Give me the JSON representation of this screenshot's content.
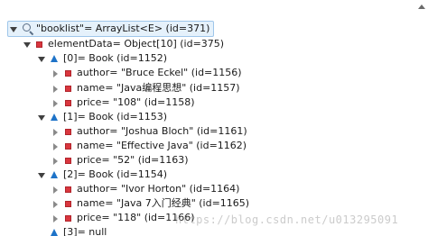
{
  "tree": {
    "root": "\"booklist\"= ArrayList<E>  (id=371)",
    "elementData": "elementData= Object[10]  (id=375)",
    "items": [
      {
        "label": "[0]= Book  (id=1152)",
        "fields": [
          "author= \"Bruce Eckel\" (id=1156)",
          "name= \"Java编程思想\" (id=1157)",
          "price= \"108\" (id=1158)"
        ]
      },
      {
        "label": "[1]= Book  (id=1153)",
        "fields": [
          "author= \"Joshua Bloch\" (id=1161)",
          "name= \"Effective Java\" (id=1162)",
          "price= \"52\" (id=1163)"
        ]
      },
      {
        "label": "[2]= Book  (id=1154)",
        "fields": [
          "author= \"Ivor Horton\" (id=1164)",
          "name= \"Java 7入门经典\" (id=1165)",
          "price= \"118\" (id=1166)"
        ]
      }
    ],
    "last": "[3]= null"
  },
  "watermark": "https://blog.csdn.net/u013295091",
  "icons": {
    "variable": "search-icon",
    "field": "private-field-icon",
    "element": "array-element-icon",
    "scroll": "scroll-up-arrow"
  },
  "colors": {
    "selection": "#e5f1fb",
    "field_icon": "#d9363e",
    "element_icon": "#1e73c8"
  }
}
